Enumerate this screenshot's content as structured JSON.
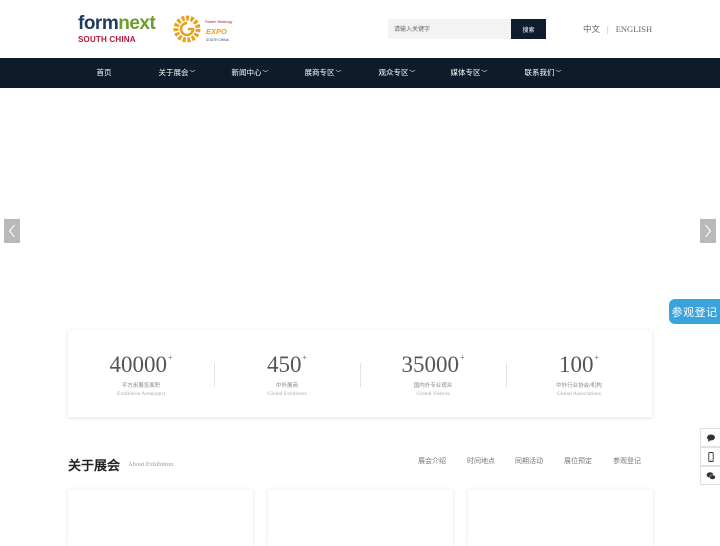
{
  "header": {
    "logo_formnext": {
      "part1": "form",
      "part2": "next",
      "subtitle": "SOUTH CHINA"
    },
    "logo_expo": {
      "line1": "Powder Metallurgy",
      "line2": "EXPO",
      "line3": "SOUTH CHINA"
    },
    "search": {
      "placeholder": "请输入关键字",
      "button_label": "搜索"
    },
    "lang": {
      "cn": "中文",
      "separator": "|",
      "en": "ENGLISH"
    }
  },
  "nav": {
    "items": [
      {
        "label": "首页",
        "has_dropdown": false
      },
      {
        "label": "关于展会",
        "has_dropdown": true
      },
      {
        "label": "新闻中心",
        "has_dropdown": true
      },
      {
        "label": "展商专区",
        "has_dropdown": true
      },
      {
        "label": "观众专区",
        "has_dropdown": true
      },
      {
        "label": "媒体专区",
        "has_dropdown": true
      },
      {
        "label": "联系我们",
        "has_dropdown": true
      }
    ],
    "dropdown_glyph": "﹀"
  },
  "banner": {
    "prev_icon": "chevron-left-icon",
    "next_icon": "chevron-right-icon"
  },
  "register_float": {
    "label": "参观登记",
    "color": "#3aa3dc"
  },
  "stats": [
    {
      "value": "40000",
      "sup": "+",
      "cn": "平方米展览面积",
      "en": "Exhibition Area(sqm)"
    },
    {
      "value": "450",
      "sup": "+",
      "cn": "中外展商",
      "en": "Global Exhibitors"
    },
    {
      "value": "35000",
      "sup": "+",
      "cn": "国内外专业观众",
      "en": "Global Visitors"
    },
    {
      "value": "100",
      "sup": "+",
      "cn": "中外行业协会/机构",
      "en": "Global Associations"
    }
  ],
  "about": {
    "title": "关于展会",
    "subtitle": "About Exhibition",
    "tabs": [
      "展会介绍",
      "时间地点",
      "同期活动",
      "展位预定",
      "参观登记"
    ]
  },
  "side_tools": [
    "chat-icon",
    "mobile-icon",
    "wechat-icon"
  ],
  "colors": {
    "nav_bg": "#0d1b2b",
    "accent_blue": "#3aa3dc",
    "brand_navy": "#1f3b5e",
    "brand_green": "#6c9e2b",
    "brand_red": "#b4193a"
  }
}
